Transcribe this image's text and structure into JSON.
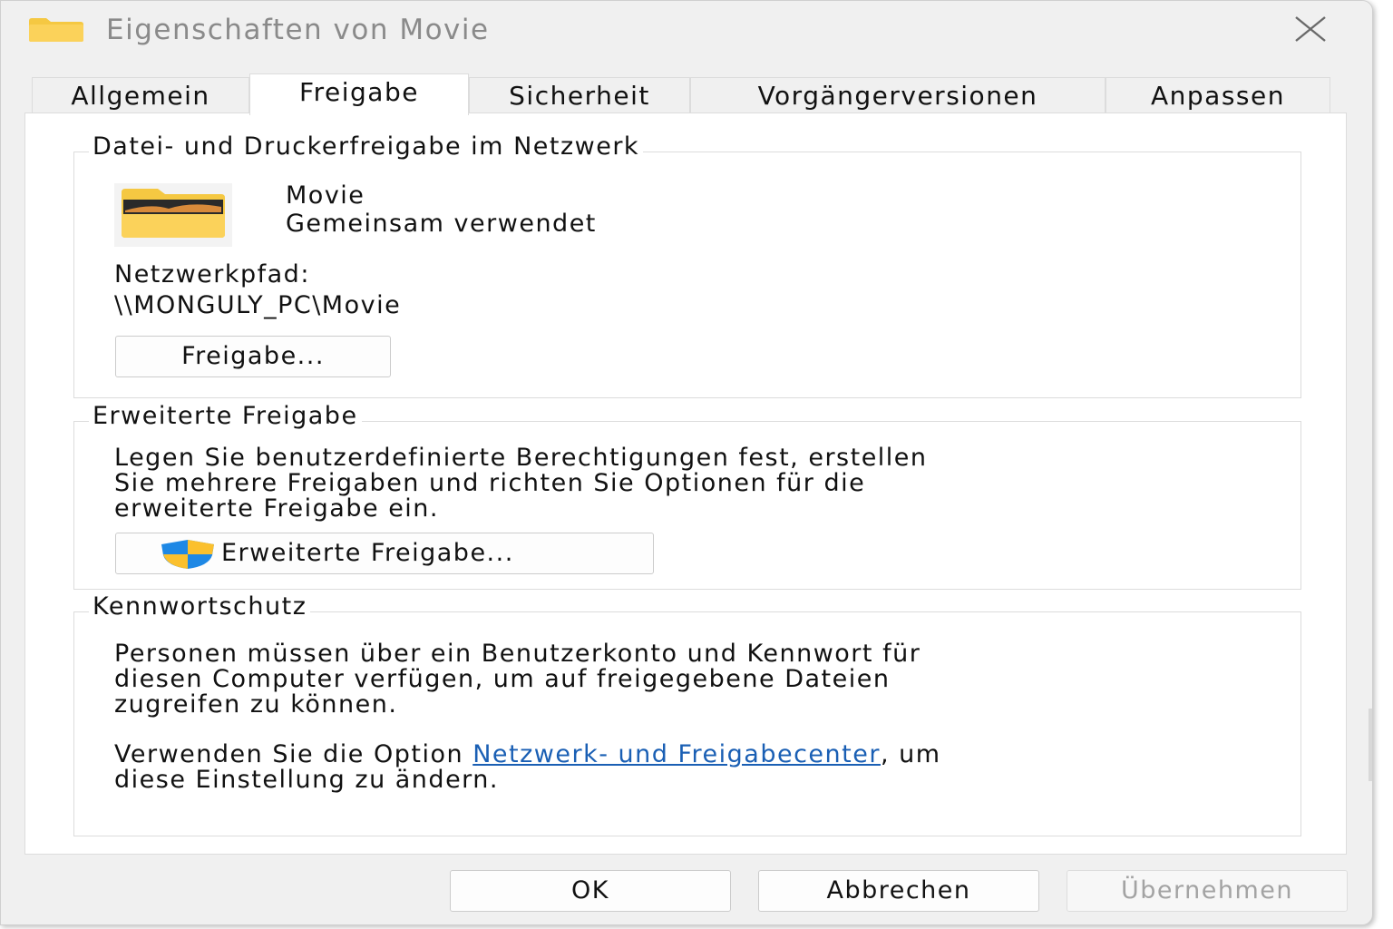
{
  "window": {
    "title": "Eigenschaften von Movie"
  },
  "tabs": [
    {
      "label": "Allgemein",
      "active": false
    },
    {
      "label": "Freigabe",
      "active": true
    },
    {
      "label": "Sicherheit",
      "active": false
    },
    {
      "label": "Vorgängerversionen",
      "active": false
    },
    {
      "label": "Anpassen",
      "active": false
    }
  ],
  "network_sharing": {
    "group_title": "Datei- und Druckerfreigabe im Netzwerk",
    "folder_name": "Movie",
    "share_status": "Gemeinsam verwendet",
    "network_path_label": "Netzwerkpfad:",
    "network_path_value": "\\\\MONGULY_PC\\Movie",
    "share_button_label": "Freigabe..."
  },
  "advanced_sharing": {
    "group_title": "Erweiterte Freigabe",
    "description_lines": [
      "Legen Sie benutzerdefinierte Berechtigungen fest, erstellen",
      "Sie mehrere Freigaben und richten Sie Optionen für die",
      "erweiterte Freigabe ein."
    ],
    "button_label": "Erweiterte Freigabe..."
  },
  "password_protection": {
    "group_title": "Kennwortschutz",
    "description_lines": [
      "Personen müssen über ein Benutzerkonto und Kennwort für",
      "diesen Computer verfügen, um auf freigegebene Dateien",
      "zugreifen zu können."
    ],
    "hint_prefix": "Verwenden Sie die Option ",
    "hint_link": "Netzwerk- und Freigabecenter",
    "hint_suffix": ", um",
    "hint_line2": "diese Einstellung zu ändern."
  },
  "footer": {
    "ok_label": "OK",
    "cancel_label": "Abbrechen",
    "apply_label": "Übernehmen",
    "apply_enabled": false
  },
  "colors": {
    "link": "#1a5fb4",
    "folder_yellow": "#f5c842",
    "shield_blue": "#1e88e5",
    "shield_yellow": "#fbc02d"
  }
}
